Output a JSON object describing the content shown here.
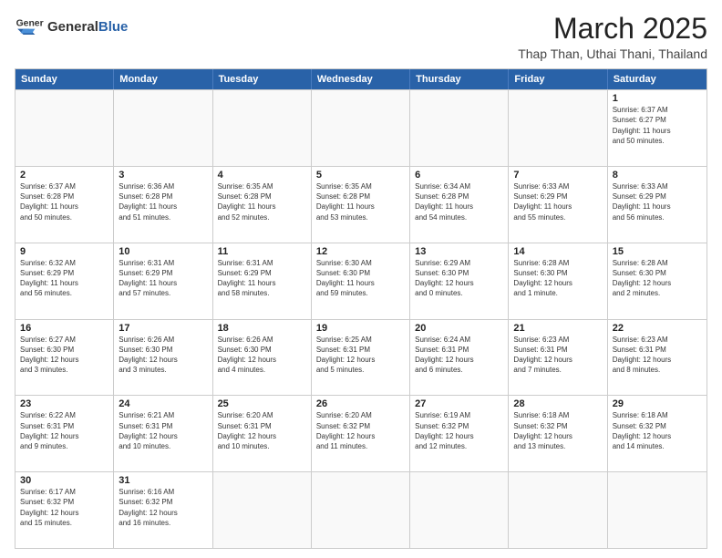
{
  "header": {
    "logo_general": "General",
    "logo_blue": "Blue",
    "main_title": "March 2025",
    "sub_title": "Thap Than, Uthai Thani, Thailand"
  },
  "days_of_week": [
    "Sunday",
    "Monday",
    "Tuesday",
    "Wednesday",
    "Thursday",
    "Friday",
    "Saturday"
  ],
  "weeks": [
    [
      {
        "day": "",
        "info": ""
      },
      {
        "day": "",
        "info": ""
      },
      {
        "day": "",
        "info": ""
      },
      {
        "day": "",
        "info": ""
      },
      {
        "day": "",
        "info": ""
      },
      {
        "day": "",
        "info": ""
      },
      {
        "day": "1",
        "info": "Sunrise: 6:37 AM\nSunset: 6:27 PM\nDaylight: 11 hours\nand 50 minutes."
      }
    ],
    [
      {
        "day": "2",
        "info": "Sunrise: 6:37 AM\nSunset: 6:28 PM\nDaylight: 11 hours\nand 50 minutes."
      },
      {
        "day": "3",
        "info": "Sunrise: 6:36 AM\nSunset: 6:28 PM\nDaylight: 11 hours\nand 51 minutes."
      },
      {
        "day": "4",
        "info": "Sunrise: 6:35 AM\nSunset: 6:28 PM\nDaylight: 11 hours\nand 52 minutes."
      },
      {
        "day": "5",
        "info": "Sunrise: 6:35 AM\nSunset: 6:28 PM\nDaylight: 11 hours\nand 53 minutes."
      },
      {
        "day": "6",
        "info": "Sunrise: 6:34 AM\nSunset: 6:28 PM\nDaylight: 11 hours\nand 54 minutes."
      },
      {
        "day": "7",
        "info": "Sunrise: 6:33 AM\nSunset: 6:29 PM\nDaylight: 11 hours\nand 55 minutes."
      },
      {
        "day": "8",
        "info": "Sunrise: 6:33 AM\nSunset: 6:29 PM\nDaylight: 11 hours\nand 56 minutes."
      }
    ],
    [
      {
        "day": "9",
        "info": "Sunrise: 6:32 AM\nSunset: 6:29 PM\nDaylight: 11 hours\nand 56 minutes."
      },
      {
        "day": "10",
        "info": "Sunrise: 6:31 AM\nSunset: 6:29 PM\nDaylight: 11 hours\nand 57 minutes."
      },
      {
        "day": "11",
        "info": "Sunrise: 6:31 AM\nSunset: 6:29 PM\nDaylight: 11 hours\nand 58 minutes."
      },
      {
        "day": "12",
        "info": "Sunrise: 6:30 AM\nSunset: 6:30 PM\nDaylight: 11 hours\nand 59 minutes."
      },
      {
        "day": "13",
        "info": "Sunrise: 6:29 AM\nSunset: 6:30 PM\nDaylight: 12 hours\nand 0 minutes."
      },
      {
        "day": "14",
        "info": "Sunrise: 6:28 AM\nSunset: 6:30 PM\nDaylight: 12 hours\nand 1 minute."
      },
      {
        "day": "15",
        "info": "Sunrise: 6:28 AM\nSunset: 6:30 PM\nDaylight: 12 hours\nand 2 minutes."
      }
    ],
    [
      {
        "day": "16",
        "info": "Sunrise: 6:27 AM\nSunset: 6:30 PM\nDaylight: 12 hours\nand 3 minutes."
      },
      {
        "day": "17",
        "info": "Sunrise: 6:26 AM\nSunset: 6:30 PM\nDaylight: 12 hours\nand 3 minutes."
      },
      {
        "day": "18",
        "info": "Sunrise: 6:26 AM\nSunset: 6:30 PM\nDaylight: 12 hours\nand 4 minutes."
      },
      {
        "day": "19",
        "info": "Sunrise: 6:25 AM\nSunset: 6:31 PM\nDaylight: 12 hours\nand 5 minutes."
      },
      {
        "day": "20",
        "info": "Sunrise: 6:24 AM\nSunset: 6:31 PM\nDaylight: 12 hours\nand 6 minutes."
      },
      {
        "day": "21",
        "info": "Sunrise: 6:23 AM\nSunset: 6:31 PM\nDaylight: 12 hours\nand 7 minutes."
      },
      {
        "day": "22",
        "info": "Sunrise: 6:23 AM\nSunset: 6:31 PM\nDaylight: 12 hours\nand 8 minutes."
      }
    ],
    [
      {
        "day": "23",
        "info": "Sunrise: 6:22 AM\nSunset: 6:31 PM\nDaylight: 12 hours\nand 9 minutes."
      },
      {
        "day": "24",
        "info": "Sunrise: 6:21 AM\nSunset: 6:31 PM\nDaylight: 12 hours\nand 10 minutes."
      },
      {
        "day": "25",
        "info": "Sunrise: 6:20 AM\nSunset: 6:31 PM\nDaylight: 12 hours\nand 10 minutes."
      },
      {
        "day": "26",
        "info": "Sunrise: 6:20 AM\nSunset: 6:32 PM\nDaylight: 12 hours\nand 11 minutes."
      },
      {
        "day": "27",
        "info": "Sunrise: 6:19 AM\nSunset: 6:32 PM\nDaylight: 12 hours\nand 12 minutes."
      },
      {
        "day": "28",
        "info": "Sunrise: 6:18 AM\nSunset: 6:32 PM\nDaylight: 12 hours\nand 13 minutes."
      },
      {
        "day": "29",
        "info": "Sunrise: 6:18 AM\nSunset: 6:32 PM\nDaylight: 12 hours\nand 14 minutes."
      }
    ],
    [
      {
        "day": "30",
        "info": "Sunrise: 6:17 AM\nSunset: 6:32 PM\nDaylight: 12 hours\nand 15 minutes."
      },
      {
        "day": "31",
        "info": "Sunrise: 6:16 AM\nSunset: 6:32 PM\nDaylight: 12 hours\nand 16 minutes."
      },
      {
        "day": "",
        "info": ""
      },
      {
        "day": "",
        "info": ""
      },
      {
        "day": "",
        "info": ""
      },
      {
        "day": "",
        "info": ""
      },
      {
        "day": "",
        "info": ""
      }
    ]
  ]
}
